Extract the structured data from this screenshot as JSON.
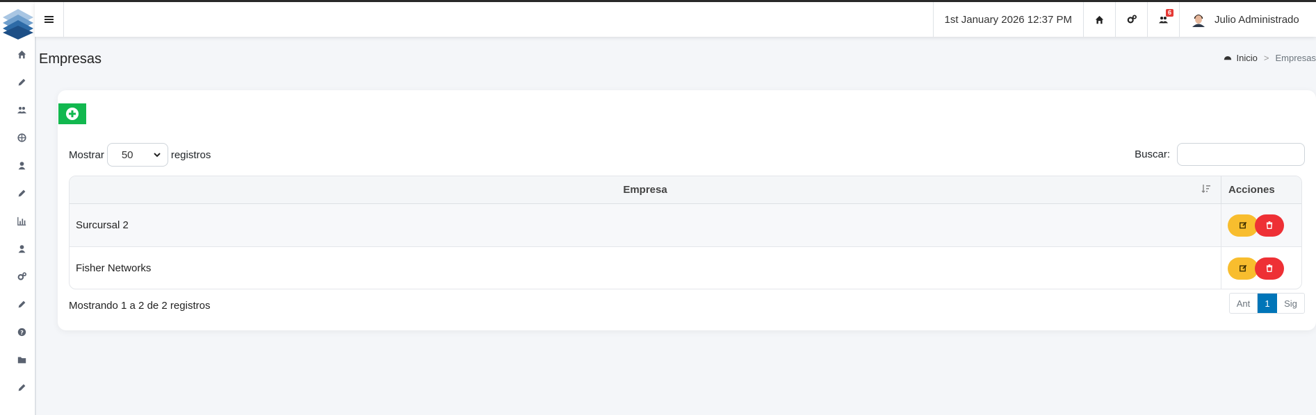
{
  "navbar": {
    "datetime": "1st January 2026 12:37 PM",
    "notification_count": "6",
    "user_name": "Julio Administrado"
  },
  "sidebar": {
    "icons": [
      "home-icon",
      "pencil-icon",
      "users-icon",
      "globe-icon",
      "user-icon",
      "pencil-icon",
      "bar-chart-icon",
      "user-icon",
      "cogs-icon",
      "pencil-icon",
      "question-icon",
      "folder-icon",
      "pencil-icon"
    ]
  },
  "page": {
    "title": "Empresas",
    "breadcrumb": {
      "home": "Inicio",
      "separator": ">",
      "current": "Empresas"
    }
  },
  "table_controls": {
    "show_label": "Mostrar",
    "page_size": "50",
    "records_label": "registros",
    "search_label": "Buscar:",
    "search_value": ""
  },
  "table": {
    "headers": {
      "empresa": "Empresa",
      "acciones": "Acciones"
    },
    "rows": [
      {
        "empresa": "Surcursal 2"
      },
      {
        "empresa": "Fisher Networks"
      }
    ]
  },
  "footer": {
    "info": "Mostrando 1 a 2 de 2 registros",
    "pagination": {
      "prev": "Ant",
      "current": "1",
      "next": "Sig"
    }
  },
  "colors": {
    "add_button": "#12b84f",
    "edit_button": "#f8bd2e",
    "delete_button": "#ee3035",
    "active_page": "#0075b8"
  }
}
